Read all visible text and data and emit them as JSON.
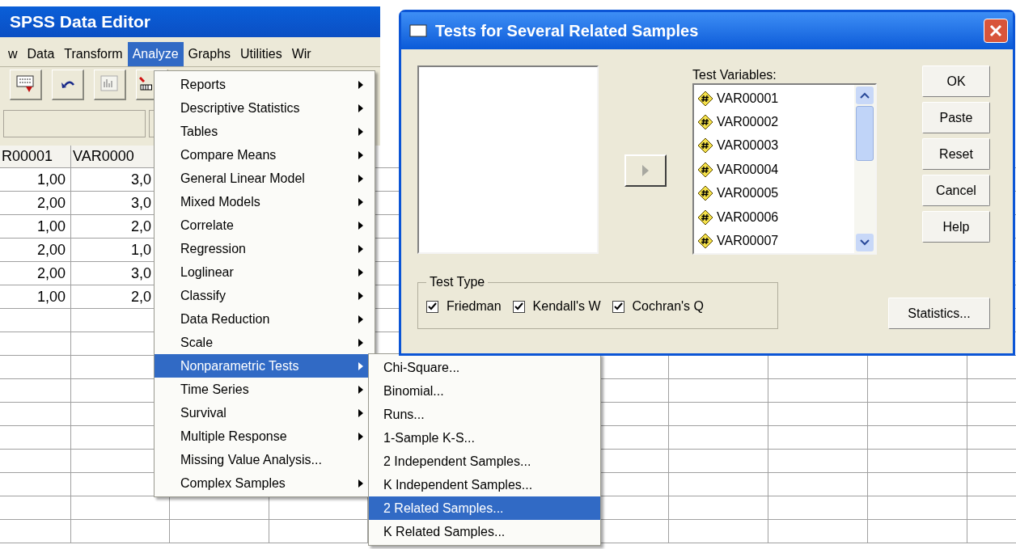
{
  "window": {
    "title": "SPSS Data Editor"
  },
  "menu_bar": [
    {
      "label": "w",
      "selected": false
    },
    {
      "label": "Data",
      "selected": false
    },
    {
      "label": "Transform",
      "selected": false
    },
    {
      "label": "Analyze",
      "selected": true
    },
    {
      "label": "Graphs",
      "selected": false
    },
    {
      "label": "Utilities",
      "selected": false
    },
    {
      "label": "Wir",
      "selected": false
    }
  ],
  "table": {
    "columns": [
      "R00001",
      "VAR0000"
    ],
    "rows": [
      [
        "1,00",
        "3,0"
      ],
      [
        "2,00",
        "3,0"
      ],
      [
        "1,00",
        "2,0"
      ],
      [
        "2,00",
        "1,0"
      ],
      [
        "2,00",
        "3,0"
      ],
      [
        "1,00",
        "2,0"
      ]
    ]
  },
  "analyze_menu": [
    {
      "label": "Reports",
      "has_submenu": true,
      "selected": false
    },
    {
      "label": "Descriptive Statistics",
      "has_submenu": true,
      "selected": false
    },
    {
      "label": "Tables",
      "has_submenu": true,
      "selected": false
    },
    {
      "label": "Compare Means",
      "has_submenu": true,
      "selected": false
    },
    {
      "label": "General Linear Model",
      "has_submenu": true,
      "selected": false
    },
    {
      "label": "Mixed Models",
      "has_submenu": true,
      "selected": false
    },
    {
      "label": "Correlate",
      "has_submenu": true,
      "selected": false
    },
    {
      "label": "Regression",
      "has_submenu": true,
      "selected": false
    },
    {
      "label": "Loglinear",
      "has_submenu": true,
      "selected": false
    },
    {
      "label": "Classify",
      "has_submenu": true,
      "selected": false
    },
    {
      "label": "Data Reduction",
      "has_submenu": true,
      "selected": false
    },
    {
      "label": "Scale",
      "has_submenu": true,
      "selected": false
    },
    {
      "label": "Nonparametric Tests",
      "has_submenu": true,
      "selected": true
    },
    {
      "label": "Time Series",
      "has_submenu": true,
      "selected": false
    },
    {
      "label": "Survival",
      "has_submenu": true,
      "selected": false
    },
    {
      "label": "Multiple Response",
      "has_submenu": true,
      "selected": false
    },
    {
      "label": "Missing Value Analysis...",
      "has_submenu": false,
      "selected": false
    },
    {
      "label": "Complex Samples",
      "has_submenu": true,
      "selected": false
    }
  ],
  "nonparametric_submenu": [
    {
      "label": "Chi-Square...",
      "selected": false
    },
    {
      "label": "Binomial...",
      "selected": false
    },
    {
      "label": "Runs...",
      "selected": false
    },
    {
      "label": "1-Sample K-S...",
      "selected": false
    },
    {
      "label": "2 Independent Samples...",
      "selected": false
    },
    {
      "label": "K Independent Samples...",
      "selected": false
    },
    {
      "label": "2 Related Samples...",
      "selected": true
    },
    {
      "label": "K Related Samples...",
      "selected": false
    }
  ],
  "dialog": {
    "title": "Tests for Several Related Samples",
    "test_variables_label": "Test Variables:",
    "test_variables": [
      "VAR00001",
      "VAR00002",
      "VAR00003",
      "VAR00004",
      "VAR00005",
      "VAR00006",
      "VAR00007"
    ],
    "buttons": [
      "OK",
      "Paste",
      "Reset",
      "Cancel",
      "Help"
    ],
    "test_type": {
      "label": "Test Type",
      "options": [
        {
          "label": "Friedman",
          "checked": true
        },
        {
          "label": "Kendall's W",
          "checked": true
        },
        {
          "label": "Cochran's Q",
          "checked": true
        }
      ]
    },
    "statistics_button": "Statistics..."
  }
}
